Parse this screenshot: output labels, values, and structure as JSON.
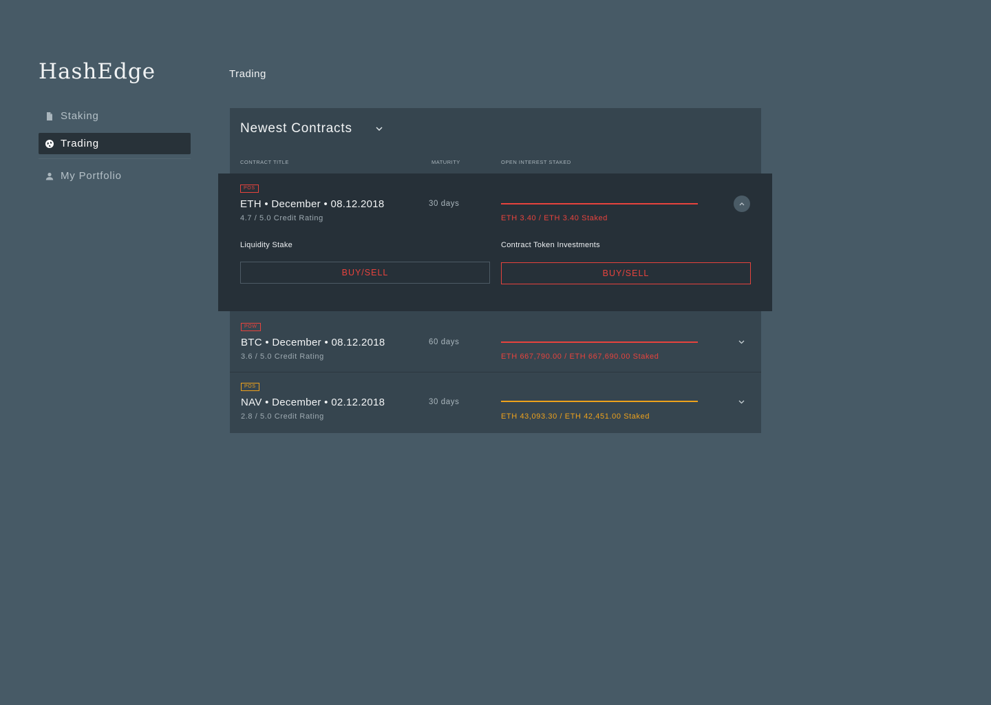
{
  "brand": {
    "name": "HashEdge"
  },
  "nav": {
    "items": [
      {
        "label": "Staking",
        "icon": "document-icon",
        "active": false
      },
      {
        "label": "Trading",
        "icon": "globe-icon",
        "active": true
      },
      {
        "label": "My Portfolio",
        "icon": "user-icon",
        "active": false
      }
    ]
  },
  "page": {
    "title": "Trading"
  },
  "panel": {
    "title": "Newest Contracts",
    "columns": {
      "title": "CONTRACT TITLE",
      "maturity": "MATURITY",
      "staked": "OPEN INTEREST STAKED"
    }
  },
  "contracts": [
    {
      "badge": "POS",
      "badge_color": "#e8433d",
      "title": "ETH • December • 08.12.2018",
      "rating": "4.7 / 5.0 Credit Rating",
      "maturity": "30 days",
      "staked": "ETH 3.40 / ETH 3.40 Staked",
      "staked_color": "#e8433d",
      "fill_fraction": 1.0,
      "expanded": true,
      "liquidity_label": "Liquidity Stake",
      "liquidity_button": "BUY/SELL",
      "token_label": "Contract Token Investments",
      "token_button": "BUY/SELL"
    },
    {
      "badge": "POW",
      "badge_color": "#e8433d",
      "title": "BTC • December • 08.12.2018",
      "rating": "3.6 / 5.0 Credit Rating",
      "maturity": "60 days",
      "staked": "ETH 667,790.00 / ETH 667,690.00 Staked",
      "staked_color": "#e8433d",
      "fill_fraction": 1.0,
      "expanded": false
    },
    {
      "badge": "POS",
      "badge_color": "#eea21c",
      "title": "NAV • December • 02.12.2018",
      "rating": "2.8 / 5.0 Credit Rating",
      "maturity": "30 days",
      "staked": "ETH 43,093.30 / ETH 42,451.00 Staked",
      "staked_color": "#eea21c",
      "fill_fraction": 1.0,
      "expanded": false
    }
  ],
  "colors": {
    "background": "#475a66",
    "panel": "#36454f",
    "expanded_row": "#263038",
    "accent_red": "#e8433d",
    "accent_orange": "#eea21c"
  }
}
